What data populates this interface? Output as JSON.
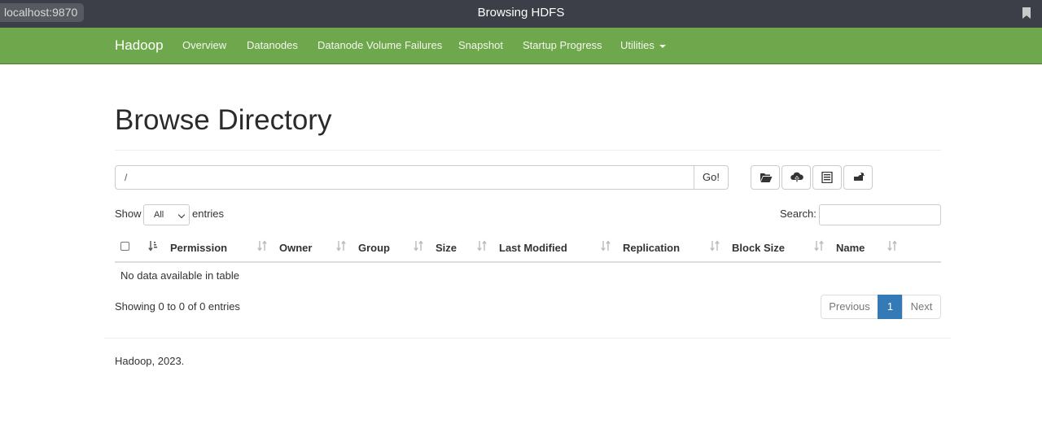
{
  "browser": {
    "url": "localhost:9870",
    "window_title": "Browsing HDFS"
  },
  "navbar": {
    "brand": "Hadoop",
    "items": [
      "Overview",
      "Datanodes",
      "Datanode Volume Failures",
      "Snapshot",
      "Startup Progress",
      "Utilities"
    ]
  },
  "main": {
    "title": "Browse Directory",
    "path_value": "/",
    "go_label": "Go!",
    "toolbar_icons": [
      "folder-open-icon",
      "cloud-upload-icon",
      "list-alt-icon",
      "scissors-icon"
    ],
    "show_label": "Show",
    "entries_value": "All",
    "entries_label": "entries",
    "search_label": "Search:",
    "search_value": ""
  },
  "table": {
    "columns": [
      "Permission",
      "Owner",
      "Group",
      "Size",
      "Last Modified",
      "Replication",
      "Block Size",
      "Name"
    ],
    "empty_message": "No data available in table",
    "info": "Showing 0 to 0 of 0 entries"
  },
  "pagination": {
    "previous": "Previous",
    "current_page": "1",
    "next": "Next"
  },
  "footer": {
    "text": "Hadoop, 2023."
  },
  "colors": {
    "navbar": "#6fa84c",
    "titlebar": "#3c3f47",
    "pagination_active": "#337ab7"
  }
}
